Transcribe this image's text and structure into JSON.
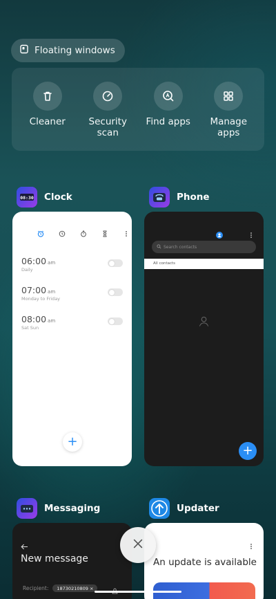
{
  "floating_windows": {
    "label": "Floating windows",
    "icon": "floating-window-icon"
  },
  "tools": [
    {
      "label": "Cleaner",
      "icon": "trash-icon"
    },
    {
      "label": "Security\nscan",
      "icon": "security-scan-icon"
    },
    {
      "label": "Find apps",
      "icon": "find-apps-icon"
    },
    {
      "label": "Manage\napps",
      "icon": "grid-icon"
    }
  ],
  "apps": {
    "clock": {
      "name": "Clock",
      "alarms": [
        {
          "time": "06:00",
          "ampm": "am",
          "repeat": "Daily"
        },
        {
          "time": "07:00",
          "ampm": "am",
          "repeat": "Monday to Friday"
        },
        {
          "time": "08:00",
          "ampm": "am",
          "repeat": "Sat Sun"
        }
      ]
    },
    "phone": {
      "name": "Phone",
      "search_placeholder": "Search contacts",
      "tab": "All contacts"
    },
    "messaging": {
      "name": "Messaging",
      "title": "New message",
      "recipient_label": "Recipient:",
      "recipient_value": "18730210809"
    },
    "updater": {
      "name": "Updater",
      "title": "An update is available"
    }
  },
  "colors": {
    "accent": "#2a8ef5",
    "updater_icon": "#1e88e5"
  }
}
